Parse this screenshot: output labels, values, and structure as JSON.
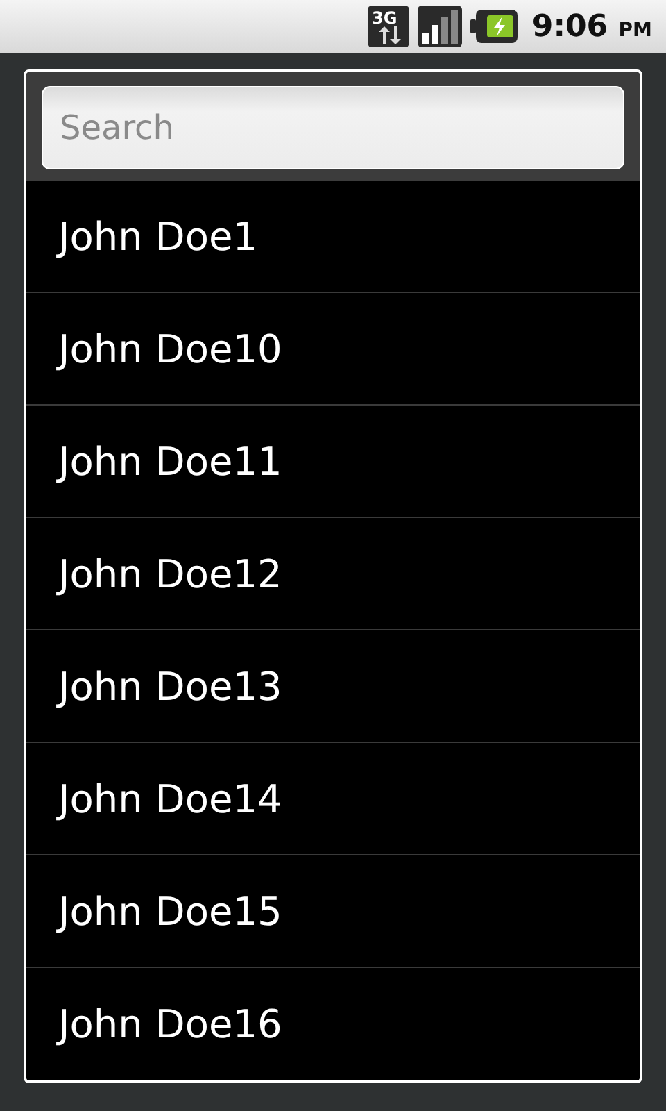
{
  "status_bar": {
    "network": "3G",
    "time": "9:06",
    "meridiem": "PM"
  },
  "search": {
    "placeholder": "Search"
  },
  "contacts": [
    {
      "name": "John Doe1"
    },
    {
      "name": "John Doe10"
    },
    {
      "name": "John Doe11"
    },
    {
      "name": "John Doe12"
    },
    {
      "name": "John Doe13"
    },
    {
      "name": "John Doe14"
    },
    {
      "name": "John Doe15"
    },
    {
      "name": "John Doe16"
    }
  ]
}
